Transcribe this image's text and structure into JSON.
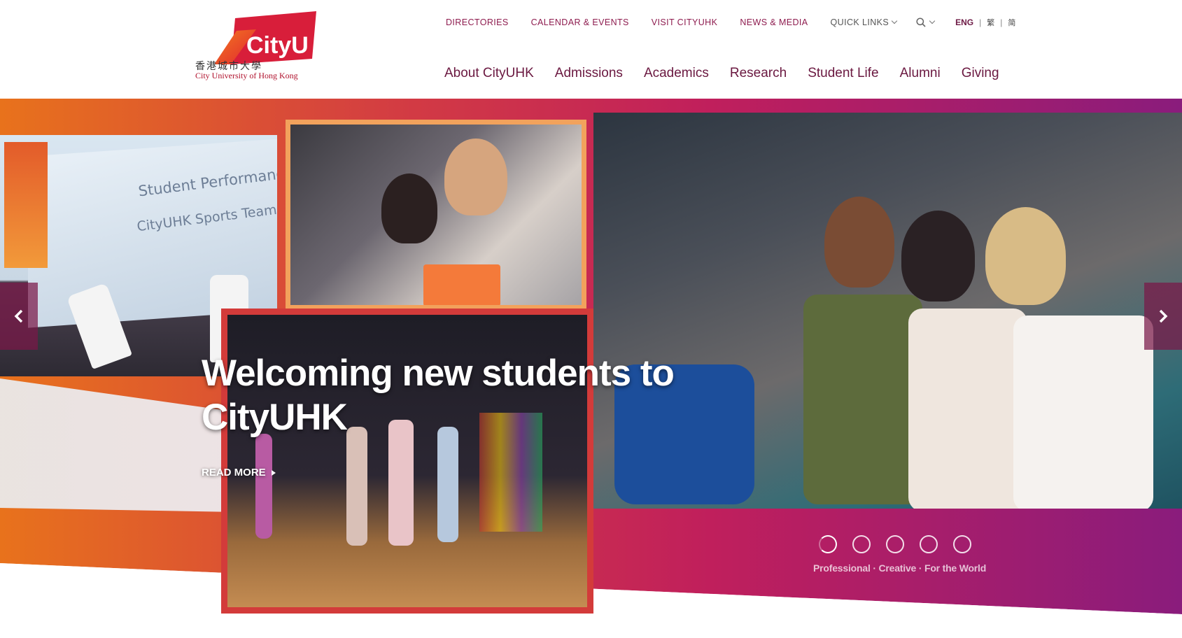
{
  "header": {
    "logo": {
      "wordmark": "CityU",
      "chinese_name": "香港城市大學",
      "english_name": "City University of Hong Kong",
      "brand_color": "#e0262f"
    },
    "utility_links": [
      {
        "label": "DIRECTORIES"
      },
      {
        "label": "CALENDAR & EVENTS"
      },
      {
        "label": "VISIT CITYUHK"
      },
      {
        "label": "NEWS & MEDIA"
      },
      {
        "label": "QUICK LINKS"
      }
    ],
    "search_icon": "search-icon",
    "languages": {
      "active": "ENG",
      "traditional": "繁",
      "simplified": "简"
    },
    "main_nav": [
      {
        "label": "About CityUHK"
      },
      {
        "label": "Admissions"
      },
      {
        "label": "Academics"
      },
      {
        "label": "Research"
      },
      {
        "label": "Student Life"
      },
      {
        "label": "Alumni"
      },
      {
        "label": "Giving"
      }
    ]
  },
  "hero": {
    "headline": "Welcoming new students to CityUHK",
    "read_more": "READ MORE",
    "photo_texts": {
      "screen_line1": "Student Performance",
      "screen_line2": "CityUHK Sports Team"
    },
    "slides_total": 5,
    "active_slide": 1,
    "tagline": "Professional · Creative · For the World",
    "colors": {
      "gradient_start": "#e8721c",
      "gradient_mid": "#c8234f",
      "gradient_end": "#8a1c7c",
      "nav_text": "#6a1840",
      "utility_text": "#8e1c4f"
    }
  }
}
